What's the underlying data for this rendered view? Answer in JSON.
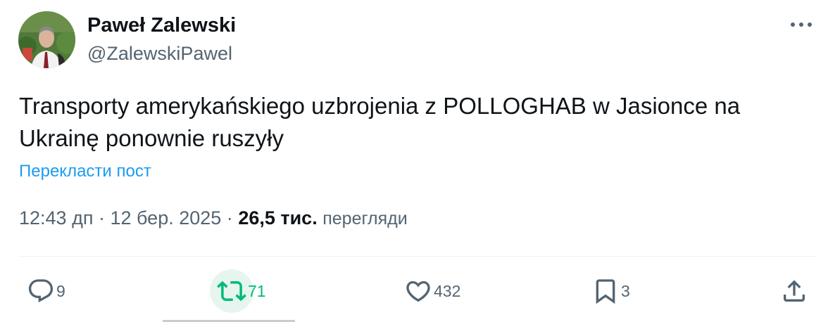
{
  "author": {
    "name": "Paweł Zalewski",
    "handle": "@ZalewskiPawel"
  },
  "tweet": {
    "text": "Transporty amerykańskiego uzbrojenia z POLLOGHAB w Jasionce na Ukrainę ponownie ruszyły",
    "translate_label": "Перекласти пост"
  },
  "meta": {
    "time": "12:43 дп",
    "separator": "·",
    "date": "12 бер. 2025",
    "views_count": "26,5 тис.",
    "views_label": "перегляди"
  },
  "actions": {
    "reply": {
      "count": "9",
      "icon": "reply-icon"
    },
    "repost": {
      "count": "71",
      "icon": "repost-icon"
    },
    "like": {
      "count": "432",
      "icon": "heart-icon"
    },
    "bookmark": {
      "count": "3",
      "icon": "bookmark-icon"
    },
    "share": {
      "icon": "share-icon"
    }
  },
  "colors": {
    "text_primary": "#0f1419",
    "text_secondary": "#536471",
    "link": "#1d9bf0",
    "repost_active": "#00ba7c",
    "repost_highlight": "#e6f6ee"
  }
}
